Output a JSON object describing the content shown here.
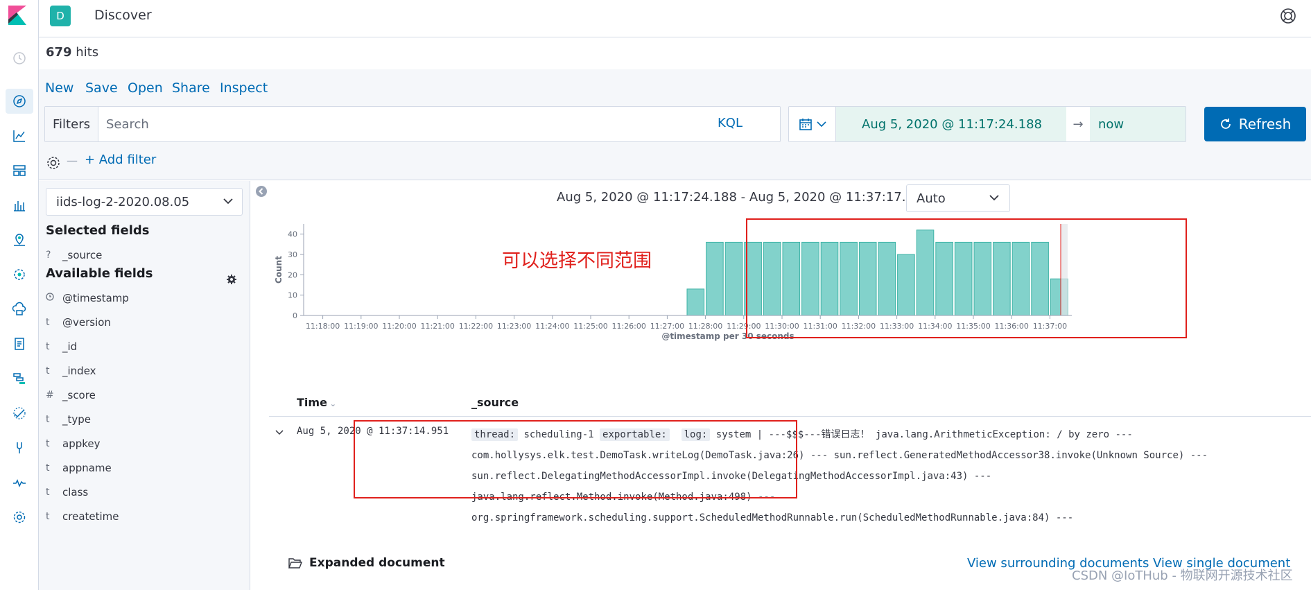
{
  "header": {
    "space_initial": "D",
    "app_title": "Discover"
  },
  "hits": {
    "count": "679",
    "label": " hits"
  },
  "menu": {
    "new": "New",
    "save": "Save",
    "open": "Open",
    "share": "Share",
    "inspect": "Inspect"
  },
  "query": {
    "filters_label": "Filters",
    "search_placeholder": "Search",
    "language": "KQL",
    "add_filter": "+ Add filter"
  },
  "time": {
    "start": "Aug 5, 2020 @ 11:17:24.188",
    "arrow": "→",
    "end": "now",
    "refresh": "Refresh"
  },
  "sidebar": {
    "index_pattern": "iids-log-2-2020.08.05",
    "selected_title": "Selected fields",
    "selected_fields": [
      {
        "type": "?",
        "name": "_source"
      }
    ],
    "available_title": "Available fields",
    "available_fields": [
      {
        "type": "clock",
        "name": "@timestamp"
      },
      {
        "type": "t",
        "name": "@version"
      },
      {
        "type": "t",
        "name": "_id"
      },
      {
        "type": "t",
        "name": "_index"
      },
      {
        "type": "#",
        "name": "_score"
      },
      {
        "type": "t",
        "name": "_type"
      },
      {
        "type": "t",
        "name": "appkey"
      },
      {
        "type": "t",
        "name": "appname"
      },
      {
        "type": "t",
        "name": "class"
      },
      {
        "type": "t",
        "name": "createtime"
      }
    ]
  },
  "histogram": {
    "range_text": "Aug 5, 2020 @ 11:17:24.188 - Aug 5, 2020 @ 11:37:17.429 —",
    "interval": "Auto"
  },
  "annotation": {
    "text": "可以选择不同范围"
  },
  "chart_data": {
    "type": "bar",
    "ylabel": "Count",
    "xlabel": "@timestamp per 30 seconds",
    "ylim": [
      0,
      45
    ],
    "yticks": [
      0,
      10,
      20,
      30,
      40
    ],
    "xticks": [
      "11:18:00",
      "11:19:00",
      "11:20:00",
      "11:21:00",
      "11:22:00",
      "11:23:00",
      "11:24:00",
      "11:25:00",
      "11:26:00",
      "11:27:00",
      "11:28:00",
      "11:29:00",
      "11:30:00",
      "11:31:00",
      "11:32:00",
      "11:33:00",
      "11:34:00",
      "11:35:00",
      "11:36:00",
      "11:37:00"
    ],
    "bars": [
      {
        "x": "11:27:30",
        "value": 13
      },
      {
        "x": "11:28:00",
        "value": 36
      },
      {
        "x": "11:28:30",
        "value": 36
      },
      {
        "x": "11:29:00",
        "value": 36
      },
      {
        "x": "11:29:30",
        "value": 36
      },
      {
        "x": "11:30:00",
        "value": 36
      },
      {
        "x": "11:30:30",
        "value": 36
      },
      {
        "x": "11:31:00",
        "value": 36
      },
      {
        "x": "11:31:30",
        "value": 36
      },
      {
        "x": "11:32:00",
        "value": 36
      },
      {
        "x": "11:32:30",
        "value": 36
      },
      {
        "x": "11:33:00",
        "value": 30
      },
      {
        "x": "11:33:30",
        "value": 42
      },
      {
        "x": "11:34:00",
        "value": 36
      },
      {
        "x": "11:34:30",
        "value": 36
      },
      {
        "x": "11:35:00",
        "value": 36
      },
      {
        "x": "11:35:30",
        "value": 36
      },
      {
        "x": "11:36:00",
        "value": 36
      },
      {
        "x": "11:36:30",
        "value": 36
      },
      {
        "x": "11:37:00",
        "value": 18
      }
    ],
    "bar_color": "#82d2cb",
    "bar_stroke": "#3eb3a6"
  },
  "table": {
    "head_time": "Time",
    "head_source": "_source",
    "row": {
      "time": "Aug 5, 2020 @ 11:37:14.951",
      "k_thread": "thread:",
      "v_thread": "scheduling-1",
      "k_exportable": "exportable:",
      "k_log": "log:",
      "v_log_line1": "system | ---$$$---错误日志！ java.lang.ArithmeticException: / by zero ---",
      "line2": "com.hollysys.elk.test.DemoTask.writeLog(DemoTask.java:26) --- sun.reflect.GeneratedMethodAccessor38.invoke(Unknown Source) ---",
      "line3": "sun.reflect.DelegatingMethodAccessorImpl.invoke(DelegatingMethodAccessorImpl.java:43) ---",
      "line4": "java.lang.reflect.Method.invoke(Method.java:498) ---",
      "line5": "org.springframework.scheduling.support.ScheduledMethodRunnable.run(ScheduledMethodRunnable.java:84) ---"
    }
  },
  "doc": {
    "expanded": "Expanded document",
    "view_surrounding": "View surrounding documents",
    "view_single": "View single document"
  },
  "watermark": "CSDN @IoTHub - 物联网开源技术社区",
  "colors": {
    "accent": "#006bb4",
    "teal": "#20b2aa",
    "annotation": "#e0201c"
  }
}
